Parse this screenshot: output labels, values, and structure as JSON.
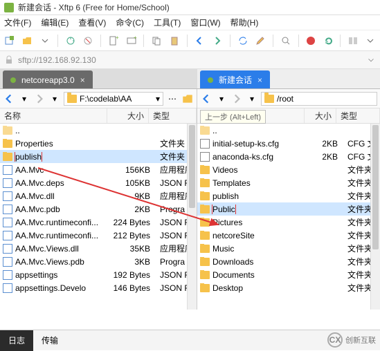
{
  "window": {
    "title": "新建会话 - Xftp 6 (Free for Home/School)"
  },
  "menus": [
    "文件(F)",
    "编辑(E)",
    "查看(V)",
    "命令(C)",
    "工具(T)",
    "窗口(W)",
    "帮助(H)"
  ],
  "address": "sftp://192.168.92.130",
  "tabs": {
    "left": "netcoreapp3.0",
    "right": "新建会话"
  },
  "left": {
    "path": "F:\\codelab\\AA",
    "cols": {
      "name": "名称",
      "size": "大小",
      "type": "类型"
    },
    "items": [
      {
        "name": "..",
        "size": "",
        "type": "",
        "kind": "up"
      },
      {
        "name": "Properties",
        "size": "",
        "type": "文件夹",
        "kind": "folder"
      },
      {
        "name": "publish",
        "size": "",
        "type": "文件夹",
        "kind": "folder",
        "mark": true,
        "sel": true
      },
      {
        "name": "AA.Mvc",
        "size": "156KB",
        "type": "应用程序",
        "kind": "file"
      },
      {
        "name": "AA.Mvc.deps",
        "size": "105KB",
        "type": "JSON F",
        "kind": "file"
      },
      {
        "name": "AA.Mvc.dll",
        "size": "9KB",
        "type": "应用程序",
        "kind": "file"
      },
      {
        "name": "AA.Mvc.pdb",
        "size": "2KB",
        "type": "Progra",
        "kind": "file"
      },
      {
        "name": "AA.Mvc.runtimeconfi...",
        "size": "224 Bytes",
        "type": "JSON F",
        "kind": "file"
      },
      {
        "name": "AA.Mvc.runtimeconfi...",
        "size": "212 Bytes",
        "type": "JSON F",
        "kind": "file"
      },
      {
        "name": "AA.Mvc.Views.dll",
        "size": "35KB",
        "type": "应用程序",
        "kind": "file"
      },
      {
        "name": "AA.Mvc.Views.pdb",
        "size": "3KB",
        "type": "Progra",
        "kind": "file"
      },
      {
        "name": "appsettings",
        "size": "192 Bytes",
        "type": "JSON F",
        "kind": "file"
      },
      {
        "name": "appsettings.Develo",
        "size": "146 Bytes",
        "type": "JSON F",
        "kind": "file"
      }
    ]
  },
  "right": {
    "path": "/root",
    "tooltip": "上一步 (Alt+Left)",
    "cols": {
      "name": "名称",
      "size": "大小",
      "type": "类型"
    },
    "items": [
      {
        "name": "..",
        "size": "",
        "type": "",
        "kind": "up"
      },
      {
        "name": "initial-setup-ks.cfg",
        "size": "2KB",
        "type": "CFG 文",
        "kind": "cfg"
      },
      {
        "name": "anaconda-ks.cfg",
        "size": "2KB",
        "type": "CFG 文",
        "kind": "cfg"
      },
      {
        "name": "Videos",
        "size": "",
        "type": "文件夹",
        "kind": "folder"
      },
      {
        "name": "Templates",
        "size": "",
        "type": "文件夹",
        "kind": "folder"
      },
      {
        "name": "publish",
        "size": "",
        "type": "文件夹",
        "kind": "folder"
      },
      {
        "name": "Public",
        "size": "",
        "type": "文件夹",
        "kind": "folder",
        "mark": true,
        "sel": true
      },
      {
        "name": "Pictures",
        "size": "",
        "type": "文件夹",
        "kind": "folder"
      },
      {
        "name": "netcoreSite",
        "size": "",
        "type": "文件夹",
        "kind": "folder"
      },
      {
        "name": "Music",
        "size": "",
        "type": "文件夹",
        "kind": "folder"
      },
      {
        "name": "Downloads",
        "size": "",
        "type": "文件夹",
        "kind": "folder"
      },
      {
        "name": "Documents",
        "size": "",
        "type": "文件夹",
        "kind": "folder"
      },
      {
        "name": "Desktop",
        "size": "",
        "type": "文件夹",
        "kind": "folder"
      }
    ]
  },
  "footer": {
    "log": "日志",
    "transfer": "传输"
  },
  "brand": "创新互联"
}
